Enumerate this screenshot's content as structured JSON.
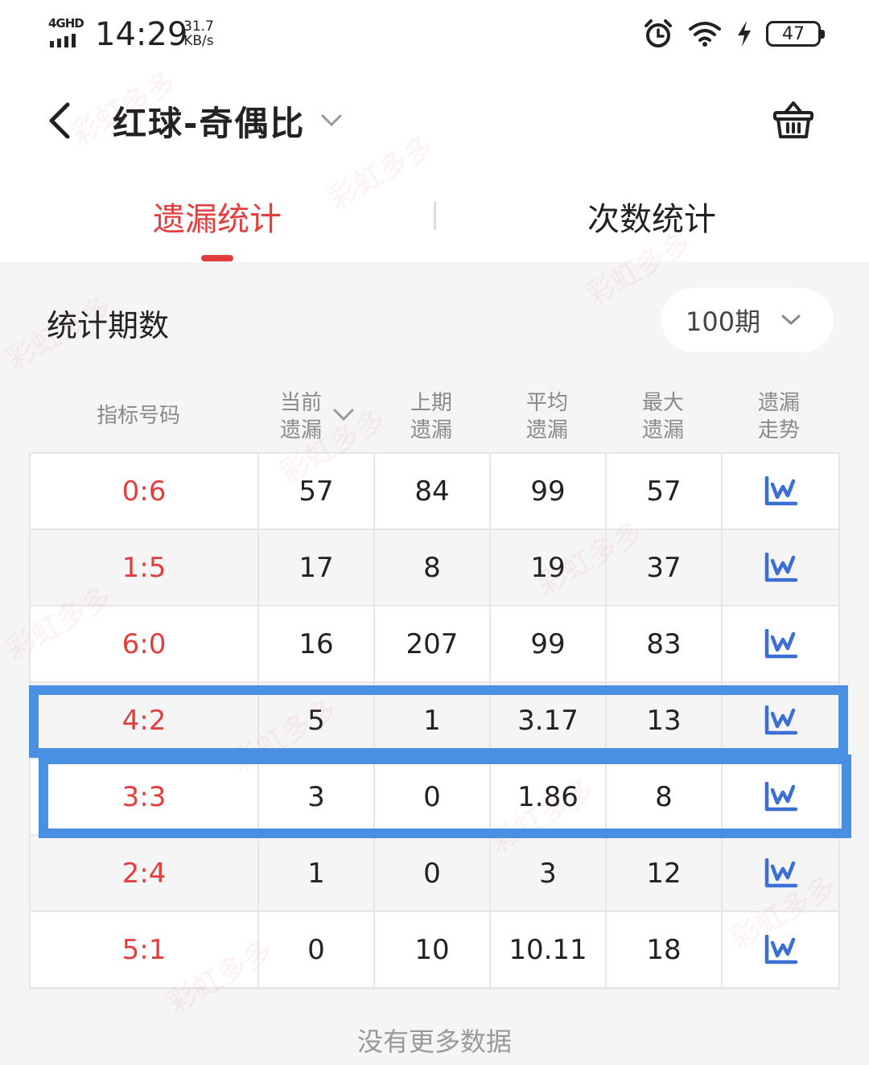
{
  "status_bar": {
    "network": "4GHD",
    "time": "14:29",
    "speed_value": "31.7",
    "speed_unit": "KB/s",
    "battery": "47"
  },
  "header": {
    "title": "红球-奇偶比"
  },
  "tabs": [
    {
      "label": "遗漏统计",
      "active": true
    },
    {
      "label": "次数统计",
      "active": false
    }
  ],
  "period": {
    "label": "统计期数",
    "selected": "100期"
  },
  "table": {
    "headers": [
      {
        "line1": "指标号码",
        "line2": ""
      },
      {
        "line1": "当前",
        "line2": "遗漏"
      },
      {
        "line1": "上期",
        "line2": "遗漏"
      },
      {
        "line1": "平均",
        "line2": "遗漏"
      },
      {
        "line1": "最大",
        "line2": "遗漏"
      },
      {
        "line1": "遗漏",
        "line2": "走势"
      }
    ],
    "rows": [
      {
        "code": "0:6",
        "current": "57",
        "last": "84",
        "avg": "99",
        "max": "57",
        "trend_icon": "line-chart-icon"
      },
      {
        "code": "1:5",
        "current": "17",
        "last": "8",
        "avg": "19",
        "max": "37",
        "trend_icon": "line-chart-icon"
      },
      {
        "code": "6:0",
        "current": "16",
        "last": "207",
        "avg": "99",
        "max": "83",
        "trend_icon": "line-chart-icon"
      },
      {
        "code": "4:2",
        "current": "5",
        "last": "1",
        "avg": "3.17",
        "max": "13",
        "trend_icon": "line-chart-icon"
      },
      {
        "code": "3:3",
        "current": "3",
        "last": "0",
        "avg": "1.86",
        "max": "8",
        "trend_icon": "line-chart-icon"
      },
      {
        "code": "2:4",
        "current": "1",
        "last": "0",
        "avg": "3",
        "max": "12",
        "trend_icon": "line-chart-icon"
      },
      {
        "code": "5:1",
        "current": "0",
        "last": "10",
        "avg": "10.11",
        "max": "18",
        "trend_icon": "line-chart-icon"
      }
    ]
  },
  "footer": {
    "no_more": "没有更多数据"
  },
  "watermark": "彩虹多多",
  "colors": {
    "accent_red": "#e33d3d",
    "chart_icon_blue": "#3b6fd6",
    "highlight_blue": "#4a90e2"
  }
}
